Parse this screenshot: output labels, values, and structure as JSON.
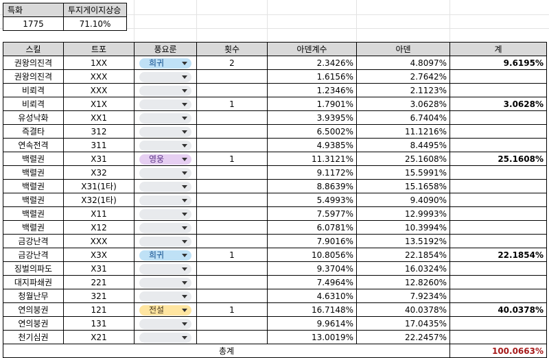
{
  "summary": {
    "headers": [
      "특화",
      "투지게이지상승"
    ],
    "values": [
      "1775",
      "71.10%"
    ]
  },
  "table": {
    "headers": [
      "스킬",
      "트포",
      "풍요룬",
      "횟수",
      "아덴계수",
      "아덴",
      "계"
    ],
    "rows": [
      {
        "skill": "권왕의진격",
        "tripod": "1XX",
        "rune": "희귀",
        "rune_color": "blue",
        "count": "2",
        "coef": "2.3426%",
        "aden": "4.8097%",
        "sum": "9.6195%"
      },
      {
        "skill": "권왕의진격",
        "tripod": "XXX",
        "rune": "",
        "rune_color": "",
        "count": "",
        "coef": "1.6156%",
        "aden": "2.7642%",
        "sum": ""
      },
      {
        "skill": "비뢰격",
        "tripod": "XXX",
        "rune": "",
        "rune_color": "",
        "count": "",
        "coef": "1.2346%",
        "aden": "2.1123%",
        "sum": ""
      },
      {
        "skill": "비뢰격",
        "tripod": "X1X",
        "rune": "",
        "rune_color": "",
        "count": "1",
        "coef": "1.7901%",
        "aden": "3.0628%",
        "sum": "3.0628%"
      },
      {
        "skill": "유성낙화",
        "tripod": "XX1",
        "rune": "",
        "rune_color": "",
        "count": "",
        "coef": "3.9395%",
        "aden": "6.7404%",
        "sum": ""
      },
      {
        "skill": "즉결타",
        "tripod": "312",
        "rune": "",
        "rune_color": "",
        "count": "",
        "coef": "6.5002%",
        "aden": "11.1216%",
        "sum": ""
      },
      {
        "skill": "연속전격",
        "tripod": "311",
        "rune": "",
        "rune_color": "",
        "count": "",
        "coef": "4.9385%",
        "aden": "8.4495%",
        "sum": ""
      },
      {
        "skill": "백렬권",
        "tripod": "X31",
        "rune": "영웅",
        "rune_color": "purple",
        "count": "1",
        "coef": "11.3121%",
        "aden": "25.1608%",
        "sum": "25.1608%"
      },
      {
        "skill": "백렬권",
        "tripod": "X32",
        "rune": "",
        "rune_color": "",
        "count": "",
        "coef": "9.1172%",
        "aden": "15.5991%",
        "sum": ""
      },
      {
        "skill": "백렬권",
        "tripod": "X31(1타)",
        "rune": "",
        "rune_color": "",
        "count": "",
        "coef": "8.8639%",
        "aden": "15.1658%",
        "sum": ""
      },
      {
        "skill": "백렬권",
        "tripod": "X32(1타)",
        "rune": "",
        "rune_color": "",
        "count": "",
        "coef": "5.4993%",
        "aden": "9.4090%",
        "sum": ""
      },
      {
        "skill": "백렬권",
        "tripod": "X11",
        "rune": "",
        "rune_color": "",
        "count": "",
        "coef": "7.5977%",
        "aden": "12.9993%",
        "sum": ""
      },
      {
        "skill": "백렬권",
        "tripod": "X12",
        "rune": "",
        "rune_color": "",
        "count": "",
        "coef": "6.0781%",
        "aden": "10.3994%",
        "sum": ""
      },
      {
        "skill": "금강난격",
        "tripod": "XXX",
        "rune": "",
        "rune_color": "",
        "count": "",
        "coef": "7.9016%",
        "aden": "13.5192%",
        "sum": ""
      },
      {
        "skill": "금강난격",
        "tripod": "X3X",
        "rune": "희귀",
        "rune_color": "blue",
        "count": "1",
        "coef": "10.8056%",
        "aden": "22.1854%",
        "sum": "22.1854%"
      },
      {
        "skill": "징벌의파도",
        "tripod": "X31",
        "rune": "",
        "rune_color": "",
        "count": "",
        "coef": "9.3704%",
        "aden": "16.0324%",
        "sum": ""
      },
      {
        "skill": "대지파쇄권",
        "tripod": "221",
        "rune": "",
        "rune_color": "",
        "count": "",
        "coef": "7.4964%",
        "aden": "12.8260%",
        "sum": ""
      },
      {
        "skill": "청월난무",
        "tripod": "321",
        "rune": "",
        "rune_color": "",
        "count": "",
        "coef": "4.6310%",
        "aden": "7.9234%",
        "sum": ""
      },
      {
        "skill": "연의붕권",
        "tripod": "121",
        "rune": "전설",
        "rune_color": "yellow",
        "count": "1",
        "coef": "16.7148%",
        "aden": "40.0378%",
        "sum": "40.0378%"
      },
      {
        "skill": "연의붕권",
        "tripod": "131",
        "rune": "",
        "rune_color": "",
        "count": "",
        "coef": "9.9614%",
        "aden": "17.0435%",
        "sum": ""
      },
      {
        "skill": "천기심권",
        "tripod": "X21",
        "rune": "",
        "rune_color": "",
        "count": "",
        "coef": "13.0019%",
        "aden": "22.2457%",
        "sum": ""
      }
    ],
    "total_label": "총계",
    "total_value": "100.0663%"
  }
}
